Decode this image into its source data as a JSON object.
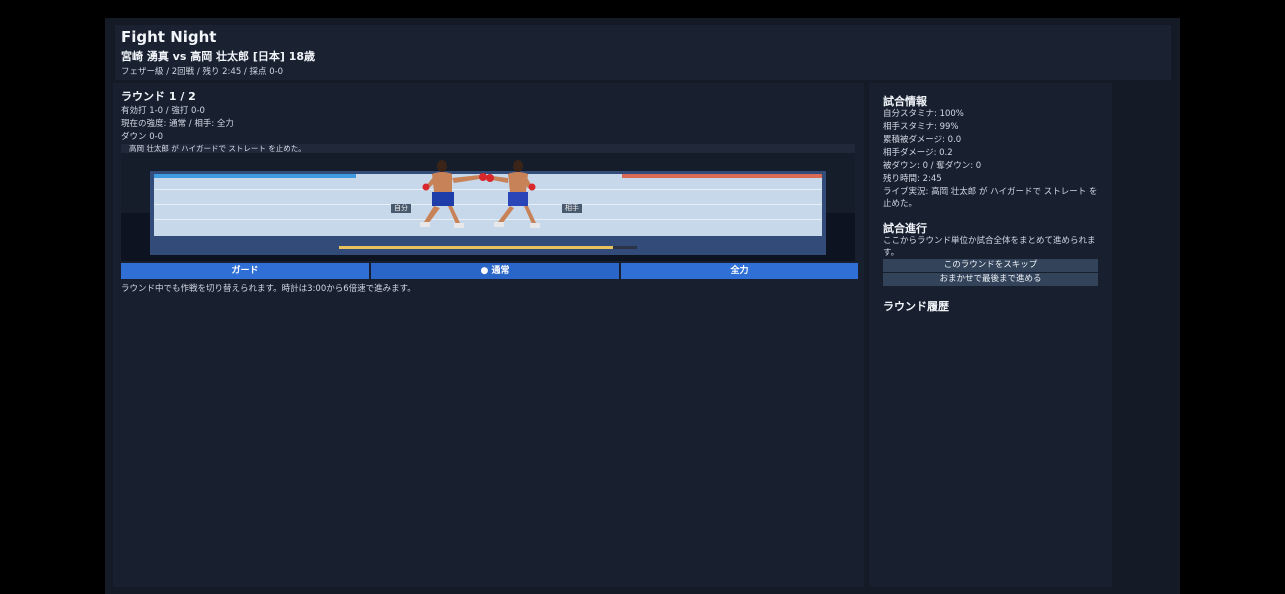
{
  "header": {
    "title": "Fight Night",
    "matchup": "宮崎 湧真 vs 高岡 壮太郎 [日本] 18歳",
    "meta": "フェザー級 / 2回戦 / 残り 2:45 / 採点 0-0"
  },
  "round": {
    "title": "ラウンド 1 / 2",
    "hits": "有効打 1-0 / 強打 0-0",
    "intensity": "現在の強度: 通常 / 相手: 全力",
    "downs": "ダウン 0-0"
  },
  "arena": {
    "log": "高岡 壮太郎 が ハイガードで ストレート を止めた。",
    "self_tag": "自分",
    "opponent_tag": "相手",
    "self_hp": 100,
    "opponent_hp": 99,
    "round_progress": 0.92,
    "colors": {
      "self": "#3e9be0",
      "opponent": "#d96a55",
      "progress": "#e8c25a"
    }
  },
  "tactics": {
    "guard": "ガード",
    "normal": "● 通常",
    "full": "全力",
    "selected": "normal"
  },
  "hint": "ラウンド中でも作戦を切り替えられます。時計は3:00から6倍速で進みます。",
  "match_info": {
    "title": "試合情報",
    "self_stamina": "自分スタミナ: 100%",
    "opp_stamina": "相手スタミナ: 99%",
    "damage_taken": "累積被ダメージ: 0.0",
    "damage_dealt": "相手ダメージ: 0.2",
    "downs": "被ダウン: 0 / 奪ダウン: 0",
    "time_left": "残り時間: 2:45",
    "live": "ライブ実況: 高岡 壮太郎 が ハイガードで ストレート を止めた。"
  },
  "progress": {
    "title": "試合進行",
    "desc": "ここからラウンド単位か試合全体をまとめて進められます。",
    "skip_round": "このラウンドをスキップ",
    "auto_finish": "おまかせで最後まで進める"
  },
  "history": {
    "title": "ラウンド履歴"
  }
}
